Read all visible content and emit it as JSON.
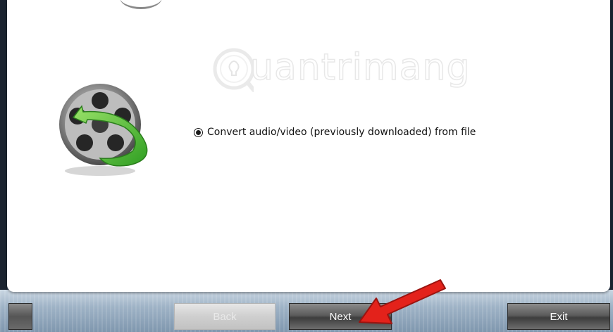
{
  "watermark": {
    "text": "uantrimang"
  },
  "option": {
    "label": "Convert audio/video (previously downloaded) from file",
    "selected": true
  },
  "buttons": {
    "back": "Back",
    "next": "Next",
    "exit": "Exit"
  },
  "icons": {
    "reel": "film-reel-convert-icon",
    "radio": "radio-selected-icon",
    "pointer": "red-arrow-pointer-icon",
    "watermark_logo": "lightbulb-logo-icon"
  },
  "colors": {
    "arrow": "#e3221b",
    "reel_arrow": "#5cc23a",
    "panel": "#ffffff",
    "button_dark": "#4a4a4a",
    "button_disabled": "#cfcfcf"
  }
}
